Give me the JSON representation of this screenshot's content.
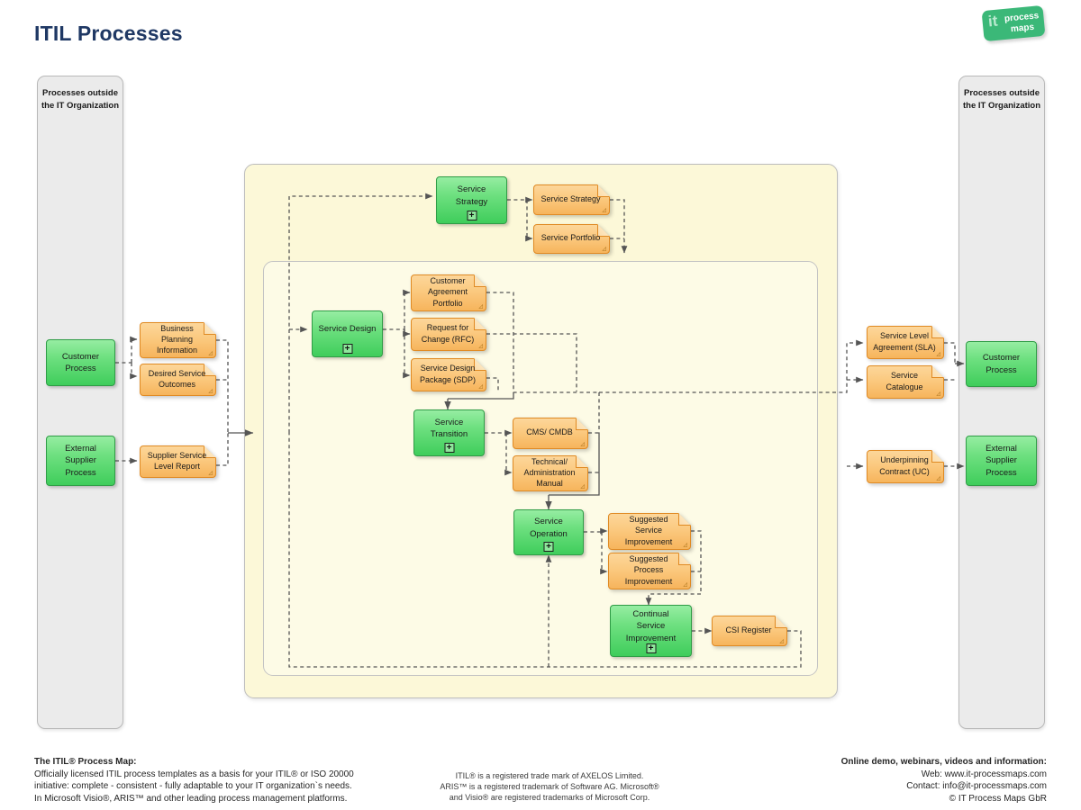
{
  "page": {
    "title": "ITIL Processes",
    "title_color": "#1f3864",
    "background": "#ffffff"
  },
  "logo": {
    "word_it": "it",
    "word_process": "process",
    "word_maps": "maps",
    "color": "#3bb878"
  },
  "lanes": {
    "left": {
      "title": "Processes\noutside the\nIT Organization"
    },
    "right": {
      "title": "Processes\noutside the\nIT Organization"
    }
  },
  "nodes": {
    "customer_process_left": {
      "label": "Customer\nProcess",
      "type": "process"
    },
    "external_supplier_process_left": {
      "label": "External\nSupplier\nProcess",
      "type": "process"
    },
    "business_planning_information": {
      "label": "Business\nPlanning\nInformation",
      "type": "document"
    },
    "desired_service_outcomes": {
      "label": "Desired Service\nOutcomes",
      "type": "document"
    },
    "supplier_service_level_report": {
      "label": "Supplier Service\nLevel Report",
      "type": "document"
    },
    "service_strategy": {
      "label": "Service\nStrategy",
      "type": "process",
      "expandable": true
    },
    "doc_service_strategy": {
      "label": "Service Strategy",
      "type": "document"
    },
    "doc_service_portfolio": {
      "label": "Service Portfolio",
      "type": "document"
    },
    "service_design": {
      "label": "Service Design",
      "type": "process",
      "expandable": true
    },
    "customer_agreement_portfolio": {
      "label": "Customer\nAgreement\nPortfolio",
      "type": "document"
    },
    "request_for_change": {
      "label": "Request for\nChange (RFC)",
      "type": "document"
    },
    "service_design_package": {
      "label": "Service Design\nPackage (SDP)",
      "type": "document"
    },
    "service_transition": {
      "label": "Service\nTransition",
      "type": "process",
      "expandable": true
    },
    "cms_cmdb": {
      "label": "CMS/ CMDB",
      "type": "document"
    },
    "technical_administration_manual": {
      "label": "Technical/\nAdministration\nManual",
      "type": "document"
    },
    "service_operation": {
      "label": "Service\nOperation",
      "type": "process",
      "expandable": true
    },
    "suggested_service_improvement": {
      "label": "Suggested\nService\nImprovement",
      "type": "document"
    },
    "suggested_process_improvement": {
      "label": "Suggested\nProcess\nImprovement",
      "type": "document"
    },
    "continual_service_improvement": {
      "label": "Continual\nService\nImprovement",
      "type": "process",
      "expandable": true
    },
    "csi_register": {
      "label": "CSI Register",
      "type": "document"
    },
    "service_level_agreement": {
      "label": "Service Level\nAgreement (SLA)",
      "type": "document"
    },
    "service_catalogue": {
      "label": "Service\nCatalogue",
      "type": "document"
    },
    "underpinning_contract": {
      "label": "Underpinning\nContract (UC)",
      "type": "document"
    },
    "customer_process_right": {
      "label": "Customer\nProcess",
      "type": "process"
    },
    "external_supplier_process_right": {
      "label": "External\nSupplier\nProcess",
      "type": "process"
    }
  },
  "expand_icon": "+",
  "colors": {
    "process_fill_top": "#96eda2",
    "process_fill_bottom": "#3fcd5b",
    "process_border": "#2f9c46",
    "document_fill_top": "#fcd69a",
    "document_fill_bottom": "#f6b45c",
    "document_border": "#e08a23",
    "container_outer": "#fcf8d8",
    "container_inner": "#fdfbe6",
    "lane_fill": "#ebebeb",
    "connector": "#555555"
  },
  "footer": {
    "left": {
      "heading": "The ITIL® Process Map:",
      "line1": "Officially licensed ITIL process templates as a basis for your ITIL® or ISO 20000",
      "line2": "initiative: complete - consistent - fully adaptable to your IT organization`s needs.",
      "line3": "In Microsoft Visio®, ARIS™ and other leading process management platforms."
    },
    "middle": {
      "line1": "ITIL® is a registered trade mark of AXELOS Limited.",
      "line2": "ARIS™ is a registered trademark of Software AG. Microsoft®",
      "line3": "and Visio® are registered trademarks of Microsoft Corp."
    },
    "right": {
      "heading": "Online demo, webinars, videos and information:",
      "line1": "Web: www.it-processmaps.com",
      "line2": "Contact: info@it-processmaps.com",
      "line3": "© IT Process Maps GbR"
    }
  }
}
